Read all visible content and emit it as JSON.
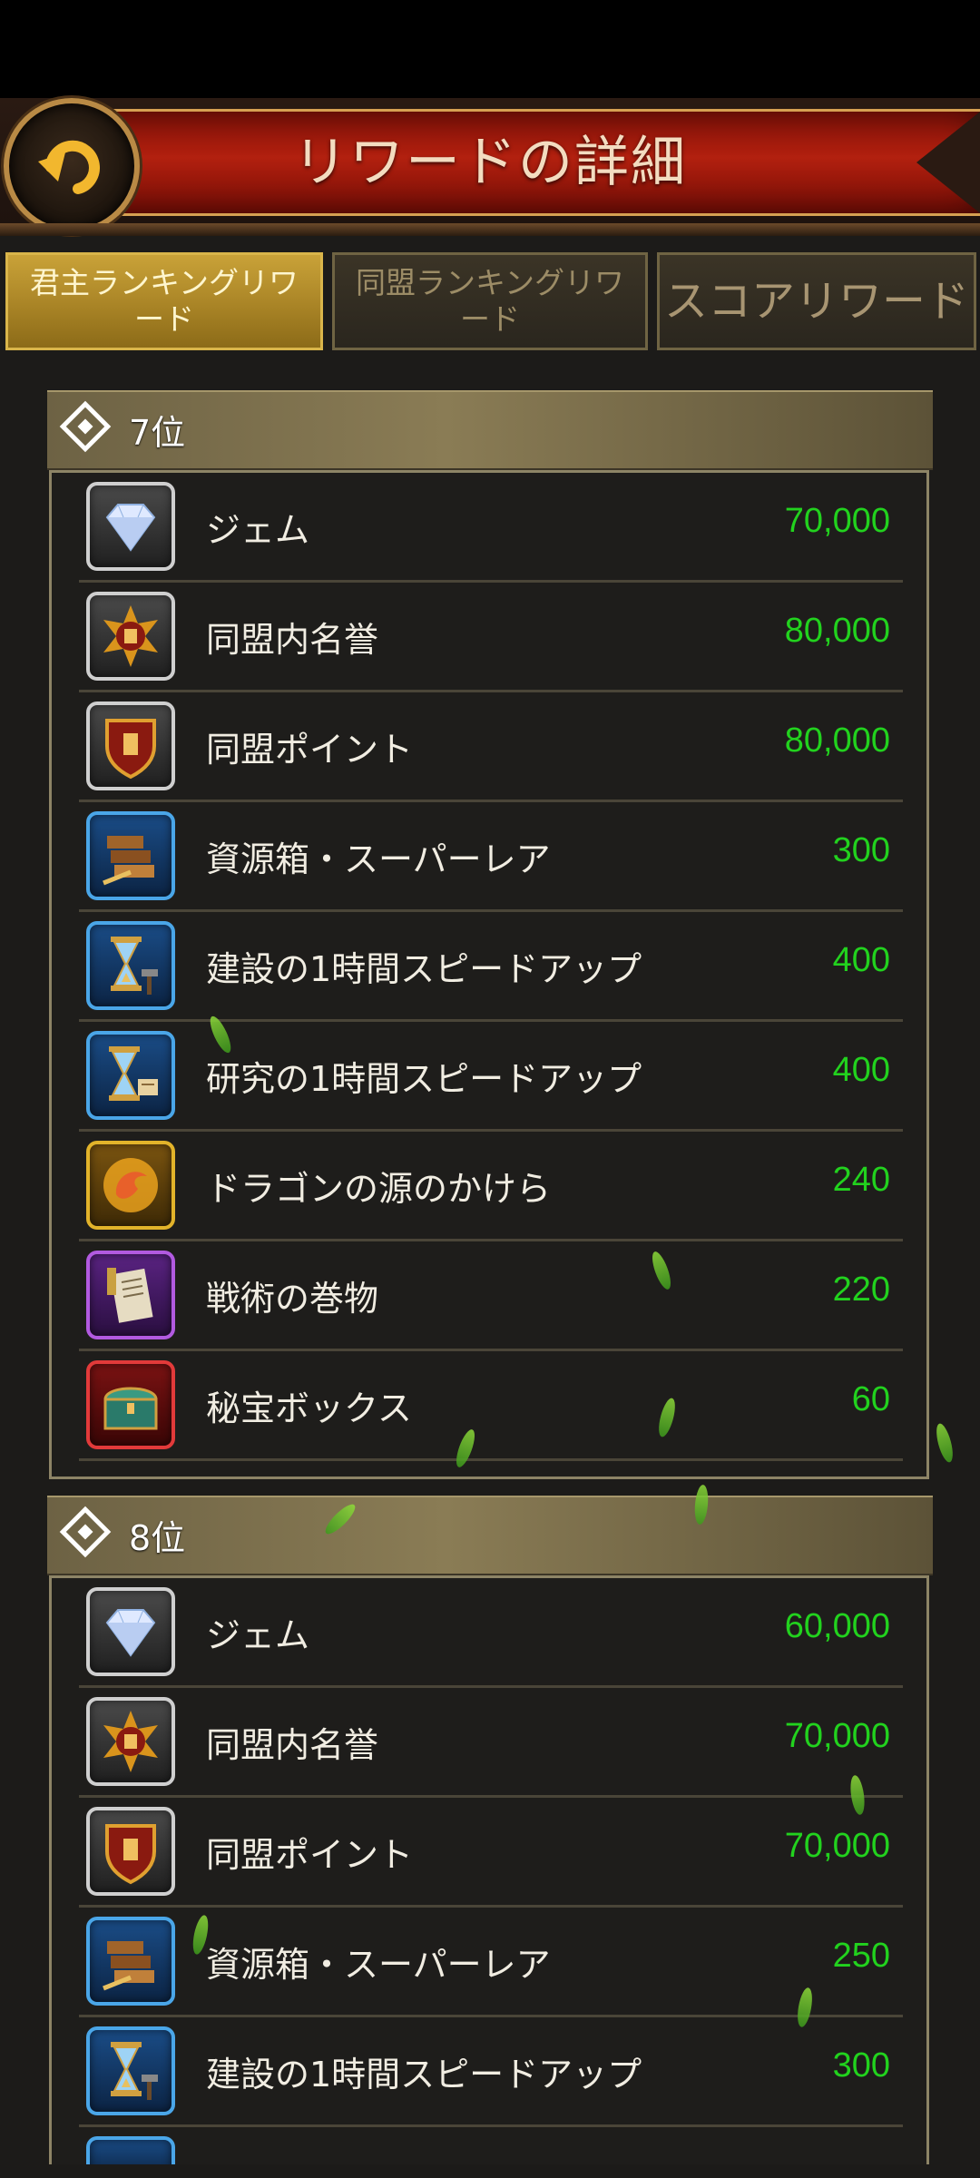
{
  "header": {
    "title": "リワードの詳細"
  },
  "tabs": [
    {
      "label": "君主ランキングリワード",
      "active": true
    },
    {
      "label": "同盟ランキングリワード",
      "active": false
    },
    {
      "label": "スコアリワード",
      "active": false
    }
  ],
  "sections": [
    {
      "rank": "7位",
      "items": [
        {
          "name": "ジェム",
          "qty": "70,000",
          "icon": "gem-icon"
        },
        {
          "name": "同盟内名誉",
          "qty": "80,000",
          "icon": "alliance-honor-icon"
        },
        {
          "name": "同盟ポイント",
          "qty": "80,000",
          "icon": "alliance-points-icon"
        },
        {
          "name": "資源箱・スーパーレア",
          "qty": "300",
          "icon": "resource-chest-icon"
        },
        {
          "name": "建設の1時間スピードアップ",
          "qty": "400",
          "icon": "build-speedup-icon"
        },
        {
          "name": "研究の1時間スピードアップ",
          "qty": "400",
          "icon": "research-speedup-icon"
        },
        {
          "name": "ドラゴンの源のかけら",
          "qty": "240",
          "icon": "dragon-shard-icon"
        },
        {
          "name": "戦術の巻物",
          "qty": "220",
          "icon": "tactics-scroll-icon"
        },
        {
          "name": "秘宝ボックス",
          "qty": "60",
          "icon": "treasure-box-icon"
        }
      ]
    },
    {
      "rank": "8位",
      "items": [
        {
          "name": "ジェム",
          "qty": "60,000",
          "icon": "gem-icon"
        },
        {
          "name": "同盟内名誉",
          "qty": "70,000",
          "icon": "alliance-honor-icon"
        },
        {
          "name": "同盟ポイント",
          "qty": "70,000",
          "icon": "alliance-points-icon"
        },
        {
          "name": "資源箱・スーパーレア",
          "qty": "250",
          "icon": "resource-chest-icon"
        },
        {
          "name": "建設の1時間スピードアップ",
          "qty": "300",
          "icon": "build-speedup-icon"
        }
      ]
    }
  ],
  "colors": {
    "quantity": "#22d21e",
    "active_tab": "#c9a238",
    "banner": "#b2200f"
  }
}
